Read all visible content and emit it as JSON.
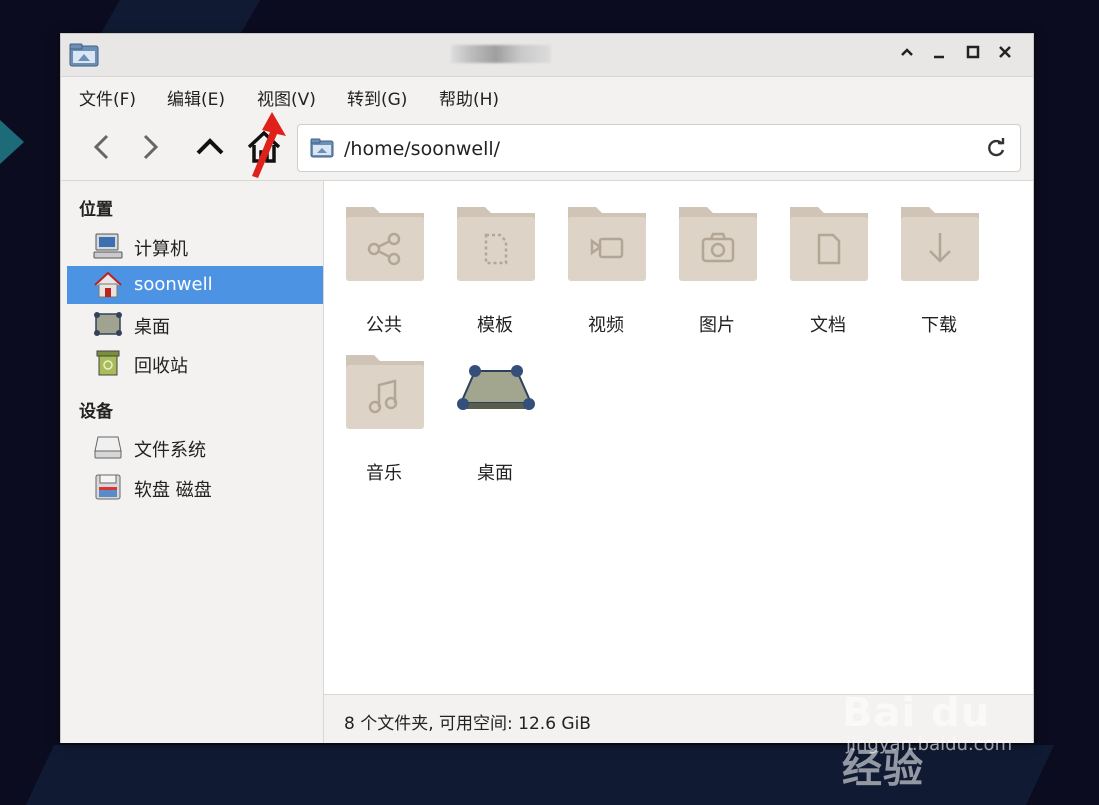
{
  "window": {
    "title": ""
  },
  "menu": {
    "file": "文件(F)",
    "edit": "编辑(E)",
    "view": "视图(V)",
    "go": "转到(G)",
    "help": "帮助(H)"
  },
  "address": {
    "path": "/home/soonwell/"
  },
  "sidebar": {
    "places_heading": "位置",
    "devices_heading": "设备",
    "places": [
      {
        "label": "计算机",
        "icon": "computer-icon"
      },
      {
        "label": "soonwell",
        "icon": "home-folder-icon",
        "selected": true
      },
      {
        "label": "桌面",
        "icon": "desktop-icon"
      },
      {
        "label": "回收站",
        "icon": "trash-icon"
      }
    ],
    "devices": [
      {
        "label": "文件系统",
        "icon": "drive-icon"
      },
      {
        "label": "软盘 磁盘",
        "icon": "floppy-icon"
      }
    ]
  },
  "files": [
    {
      "label": "公共",
      "icon": "folder-public-icon"
    },
    {
      "label": "模板",
      "icon": "folder-templates-icon"
    },
    {
      "label": "视频",
      "icon": "folder-videos-icon"
    },
    {
      "label": "图片",
      "icon": "folder-pictures-icon"
    },
    {
      "label": "文档",
      "icon": "folder-documents-icon"
    },
    {
      "label": "下载",
      "icon": "folder-download-icon"
    },
    {
      "label": "音乐",
      "icon": "folder-music-icon"
    },
    {
      "label": "桌面",
      "icon": "desktop-icon"
    }
  ],
  "status": {
    "text": "8 个文件夹, 可用空间: 12.6 GiB"
  },
  "watermark": {
    "logo": "Bai du 经验",
    "url": "jingyan.baidu.com"
  },
  "colors": {
    "selection": "#4c93e3",
    "folder": "#ddd3c7",
    "folder_tab": "#cfc4b6",
    "annotation_arrow": "#e0201a"
  }
}
